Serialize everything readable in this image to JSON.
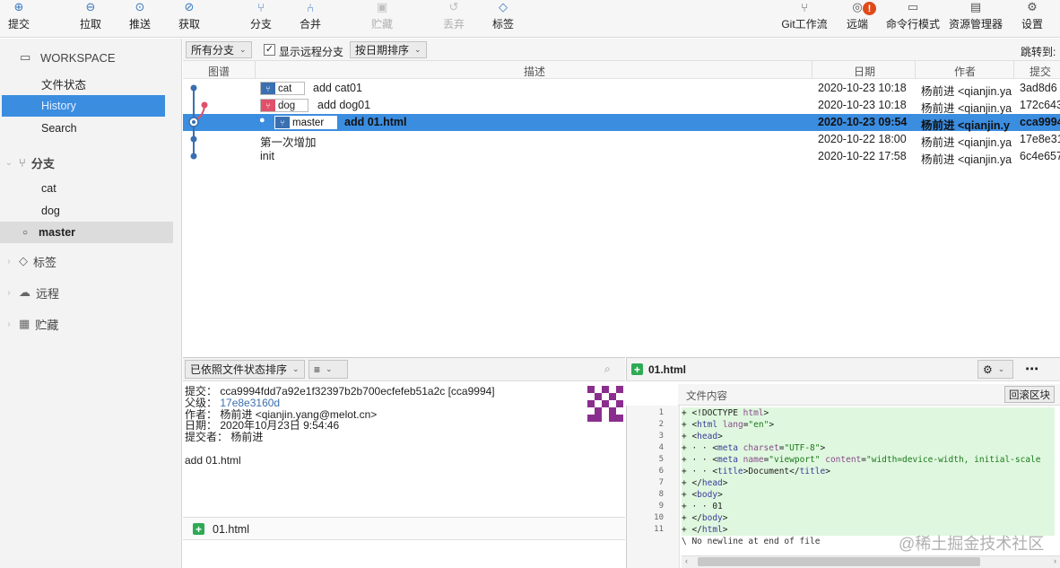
{
  "toolbar": {
    "commit": "提交",
    "pull": "拉取",
    "push": "推送",
    "fetch": "获取",
    "branch": "分支",
    "merge": "合并",
    "stash": "贮藏",
    "discard": "丢弃",
    "tag": "标签",
    "gitflow": "Git工作流",
    "remote": "远端",
    "remote_badge": "!",
    "terminal": "命令行模式",
    "explorer": "资源管理器",
    "settings": "设置"
  },
  "sidebar": {
    "workspace": "WORKSPACE",
    "file_status": "文件状态",
    "history": "History",
    "search": "Search",
    "branches_header": "分支",
    "branches": [
      "cat",
      "dog",
      "master"
    ],
    "tags_header": "标签",
    "remotes_header": "远程",
    "stashes_header": "贮藏"
  },
  "filterbar": {
    "all_branches": "所有分支",
    "show_remote": "显示远程分支",
    "sort_by_date": "按日期排序",
    "jump_to": "跳转到:"
  },
  "columns": {
    "graph": "图谱",
    "description": "描述",
    "date": "日期",
    "author": "作者",
    "commit": "提交"
  },
  "commits": [
    {
      "branch": "cat",
      "msg": "add cat01",
      "date": "2020-10-23 10:18",
      "author": "杨前进 <qianjin.ya",
      "hash": "3ad8d6"
    },
    {
      "branch": "dog",
      "msg": "add dog01",
      "date": "2020-10-23 10:18",
      "author": "杨前进 <qianjin.ya",
      "hash": "172c643"
    },
    {
      "branch": "master",
      "msg": "add 01.html",
      "date": "2020-10-23 09:54",
      "author": "杨前进 <qianjin.y",
      "hash": "cca9994"
    },
    {
      "branch": "",
      "msg": "第一次增加",
      "date": "2020-10-22 18:00",
      "author": "杨前进 <qianjin.ya",
      "hash": "17e8e31"
    },
    {
      "branch": "",
      "msg": "init",
      "date": "2020-10-22 17:58",
      "author": "杨前进 <qianjin.ya",
      "hash": "6c4e657"
    }
  ],
  "details": {
    "sort_label": "已依照文件状态排序",
    "commit_label": "提交：",
    "commit_value": "cca9994fdd7a92e1f32397b2b700ecfefeb51a2c [cca9994]",
    "parent_label": "父级：",
    "parent_value": "17e8e3160d",
    "author_label": "作者：",
    "author_value": "杨前进 <qianjin.yang@melot.cn>",
    "date_label": "日期：",
    "date_value": "2020年10月23日 9:54:46",
    "committer_label": "提交者：",
    "committer_value": "杨前进",
    "message": "add 01.html",
    "file": "01.html"
  },
  "diff": {
    "file": "01.html",
    "content_label": "文件内容",
    "revert_hunk": "回滚区块",
    "no_newline": "\\ No newline at end of file",
    "line_numbers": [
      "1",
      "2",
      "3",
      "4",
      "5",
      "6",
      "7",
      "8",
      "9",
      "10",
      "11"
    ]
  },
  "watermark": "@稀土掘金技术社区"
}
